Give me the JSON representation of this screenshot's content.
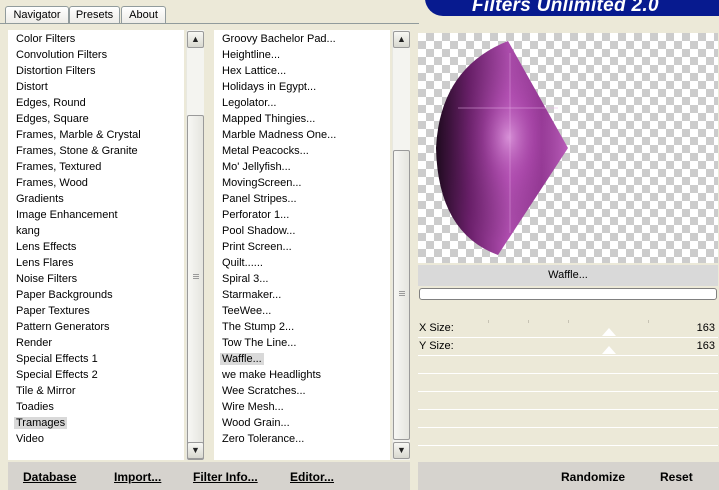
{
  "tabs": [
    {
      "label": "Navigator",
      "active": true
    },
    {
      "label": "Presets",
      "active": false
    },
    {
      "label": "About",
      "active": false
    }
  ],
  "banner": {
    "title": "Filters Unlimited 2.0"
  },
  "categories": {
    "items": [
      "Color Filters",
      "Convolution Filters",
      "Distortion Filters",
      "Distort",
      "Edges, Round",
      "Edges, Square",
      "Frames, Marble & Crystal",
      "Frames, Stone & Granite",
      "Frames, Textured",
      "Frames, Wood",
      "Gradients",
      "Image Enhancement",
      "kang",
      "Lens Effects",
      "Lens Flares",
      "Noise Filters",
      "Paper Backgrounds",
      "Paper Textures",
      "Pattern Generators",
      "Render",
      "Special Effects 1",
      "Special Effects 2",
      "Tile & Mirror",
      "Toadies",
      "Tramages",
      "Video"
    ],
    "selected": "Tramages"
  },
  "filters": {
    "items": [
      "Groovy Bachelor Pad...",
      "Heightline...",
      "Hex Lattice...",
      "Holidays in Egypt...",
      "Legolator...",
      "Mapped Thingies...",
      "Marble Madness One...",
      "Metal Peacocks...",
      "Mo' Jellyfish...",
      "MovingScreen...",
      "Panel Stripes...",
      "Perforator 1...",
      "Pool Shadow...",
      "Print Screen...",
      "Quilt......",
      "Spiral 3...",
      "Starmaker...",
      "TeeWee...",
      "The Stump 2...",
      "Tow The Line...",
      "Waffle...",
      "we make Headlights",
      "Wee Scratches...",
      "Wire Mesh...",
      "Wood Grain...",
      "Zero Tolerance..."
    ],
    "selected": "Waffle..."
  },
  "preview": {
    "filter_name": "Waffle...",
    "progress": 0
  },
  "params": [
    {
      "label": "X Size:",
      "value": "163"
    },
    {
      "label": "Y Size:",
      "value": "163"
    }
  ],
  "buttons": {
    "database": "Database",
    "import": "Import...",
    "filter_info": "Filter Info...",
    "editor": "Editor...",
    "randomize": "Randomize",
    "reset": "Reset"
  },
  "colors": {
    "banner": "#071a8f",
    "selection": "#d9d9d9",
    "shape_purple": "#9a3a9a"
  }
}
